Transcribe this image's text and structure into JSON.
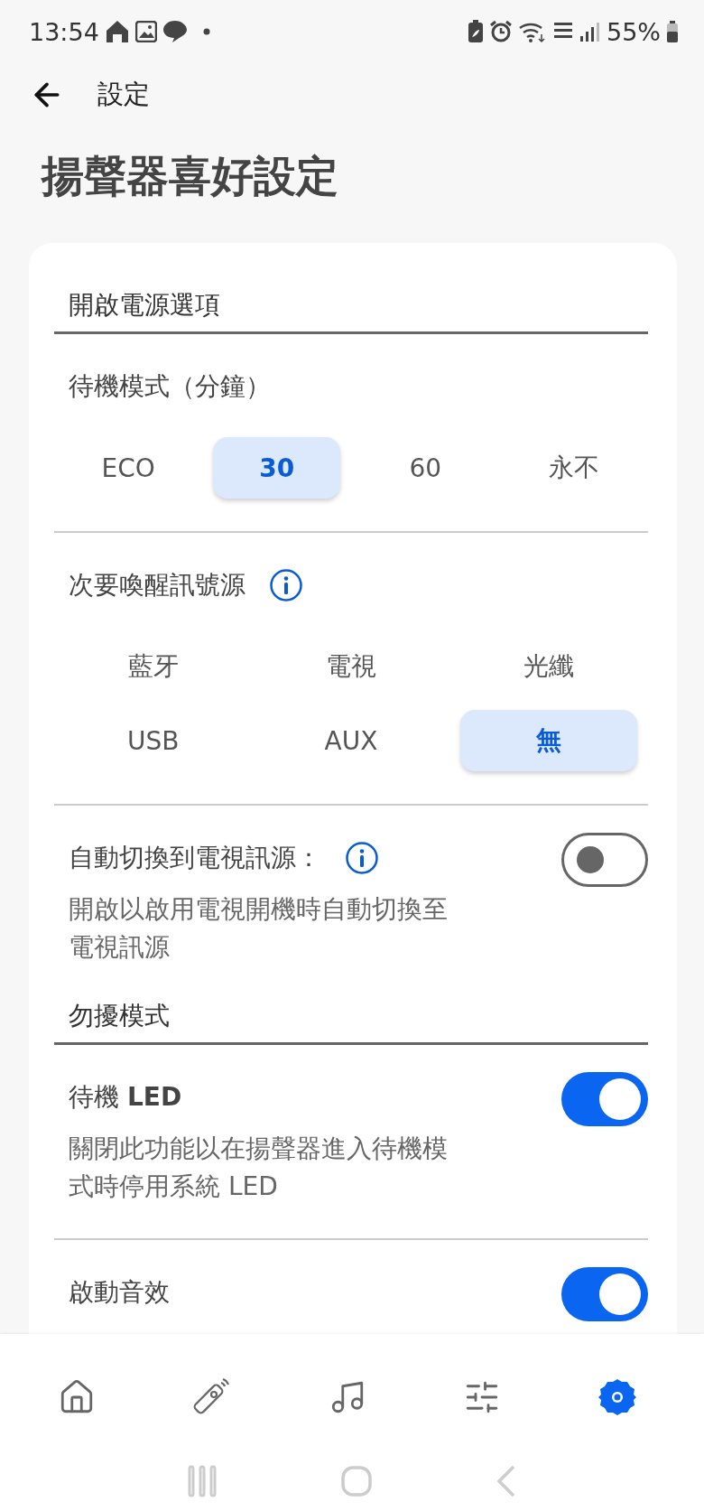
{
  "status_bar": {
    "time": "13:54",
    "battery": "55%"
  },
  "header": {
    "back_label": "設定"
  },
  "title": "揚聲器喜好設定",
  "sections": [
    {
      "heading": "開啟電源選項",
      "items": [
        {
          "kind": "segments",
          "label": "待機模式（分鐘）",
          "info": false,
          "options": [
            {
              "label": "ECO",
              "selected": false
            },
            {
              "label": "30",
              "selected": true
            },
            {
              "label": "60",
              "selected": false
            },
            {
              "label": "永不",
              "selected": false
            }
          ]
        },
        {
          "kind": "grid",
          "label": "次要喚醒訊號源",
          "info": true,
          "options": [
            {
              "label": "藍牙",
              "selected": false
            },
            {
              "label": "電視",
              "selected": false
            },
            {
              "label": "光纖",
              "selected": false
            },
            {
              "label": "USB",
              "selected": false
            },
            {
              "label": "AUX",
              "selected": false
            },
            {
              "label": "無",
              "selected": true
            }
          ]
        },
        {
          "kind": "toggle",
          "label": "自動切換到電視訊源：",
          "info": true,
          "on": false,
          "description": "開啟以啟用電視開機時自動切換至電視訊源"
        }
      ]
    },
    {
      "heading": "勿擾模式",
      "items": [
        {
          "kind": "toggle",
          "label": "待機 **LED**",
          "info": false,
          "on": true,
          "description": "關閉此功能以在揚聲器進入待機模式時停用系統 LED"
        },
        {
          "kind": "toggle",
          "label": "啟動音效",
          "info": false,
          "on": true
        }
      ]
    }
  ],
  "bottom_nav": [
    {
      "selected": false
    },
    {
      "selected": false
    },
    {
      "selected": false
    },
    {
      "selected": false
    },
    {
      "selected": true
    }
  ]
}
